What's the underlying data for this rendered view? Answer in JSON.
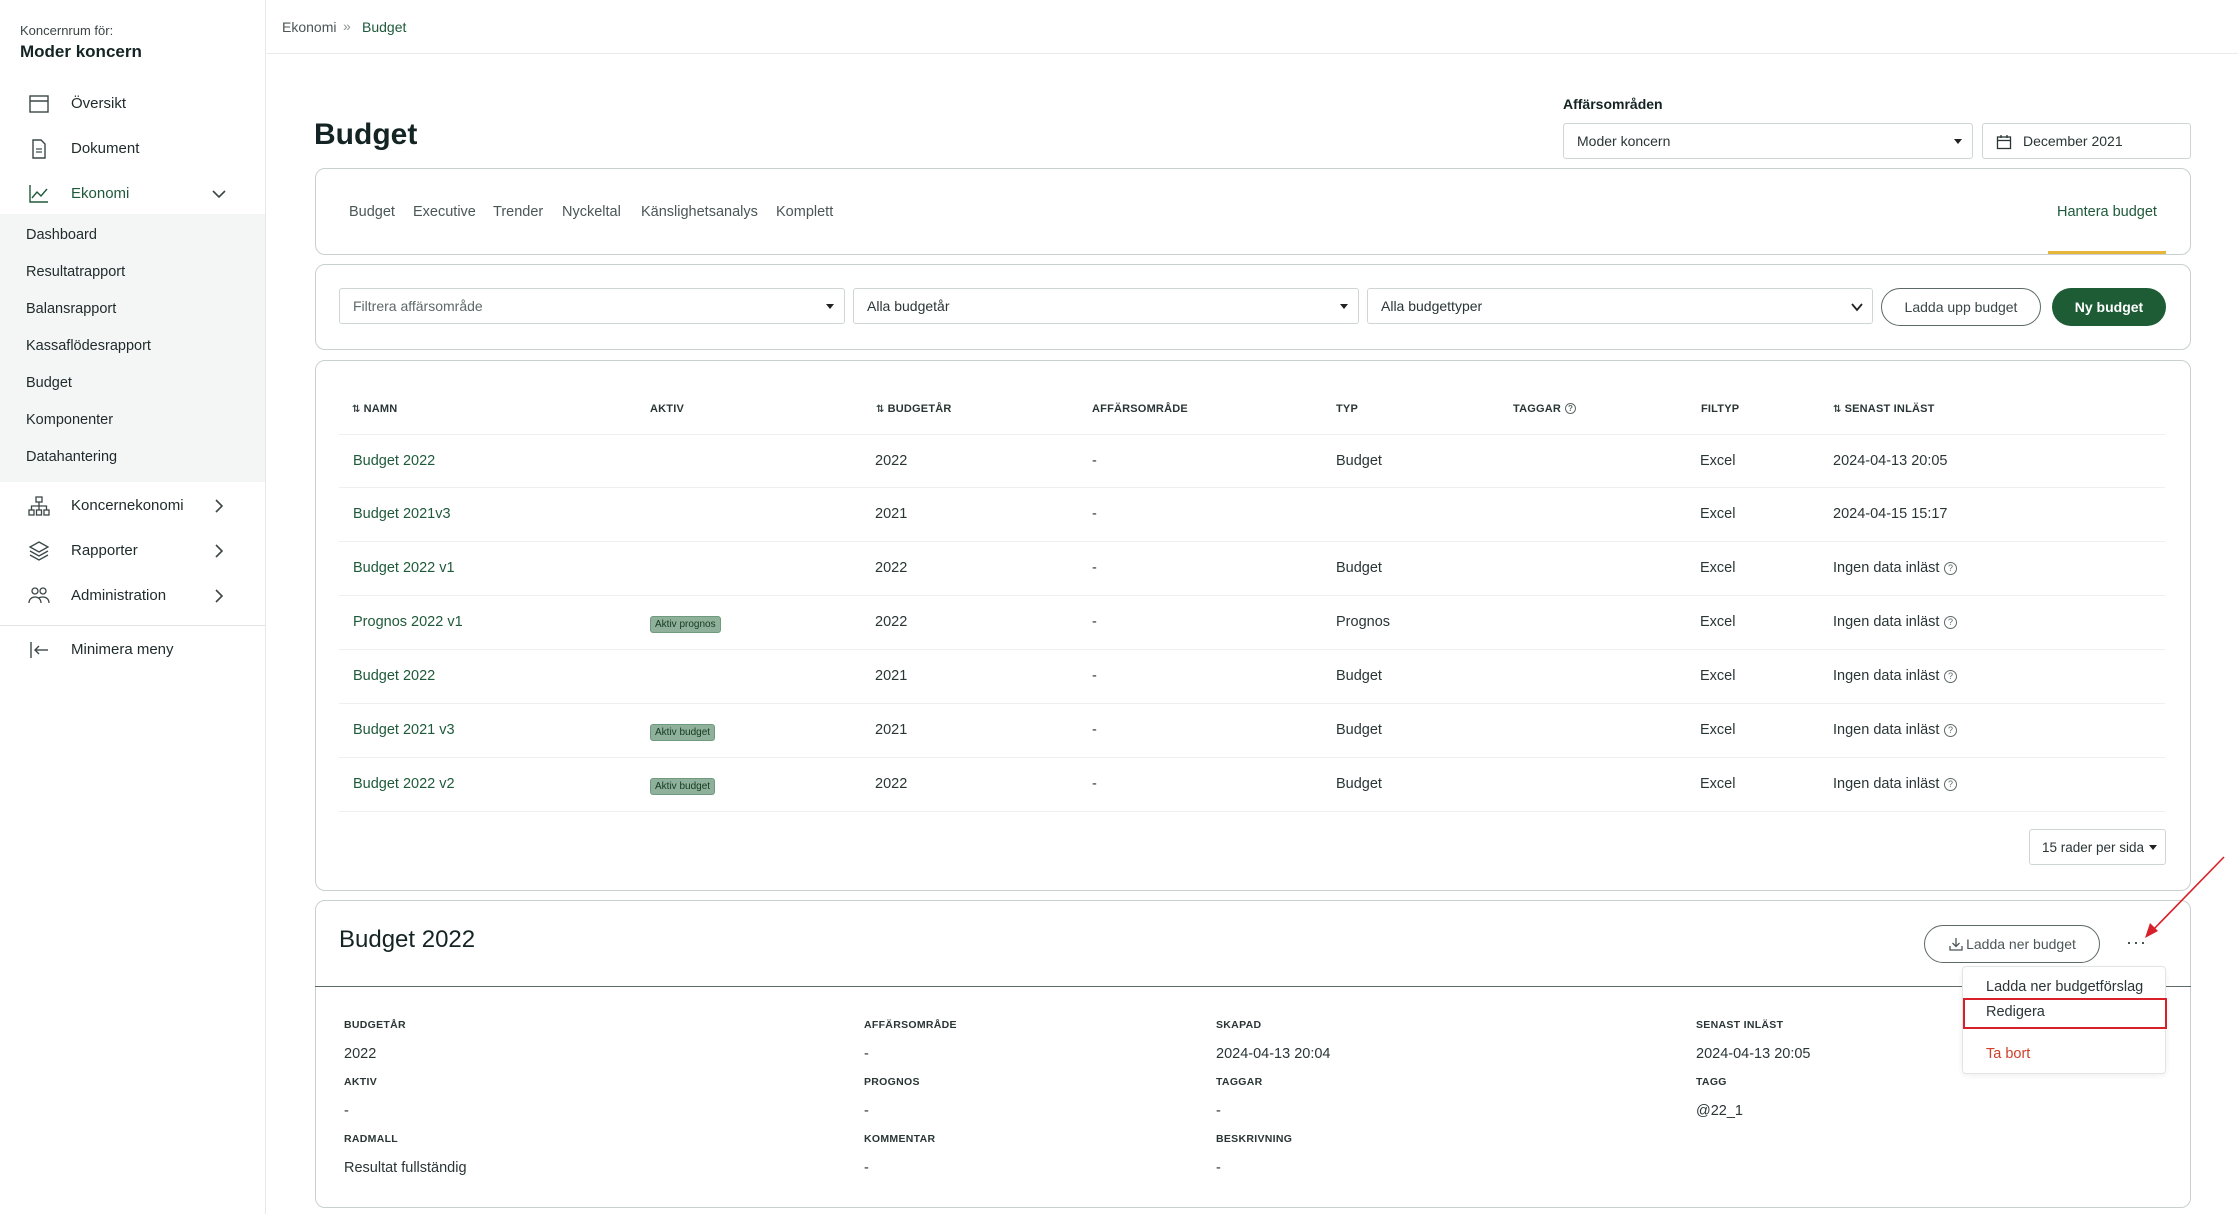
{
  "sidebar": {
    "org_label": "Koncernrum för:",
    "org_name": "Moder koncern",
    "items": [
      {
        "label": "Översikt",
        "icon": "calendar-icon"
      },
      {
        "label": "Dokument",
        "icon": "document-icon"
      },
      {
        "label": "Ekonomi",
        "icon": "chart-line-icon"
      },
      {
        "label": "Koncernekonomi",
        "icon": "org-chart-icon"
      },
      {
        "label": "Rapporter",
        "icon": "layers-icon"
      },
      {
        "label": "Administration",
        "icon": "users-icon"
      },
      {
        "label": "Minimera meny",
        "icon": "collapse-left-icon"
      }
    ],
    "ekonomi_sub": [
      "Dashboard",
      "Resultatrapport",
      "Balansrapport",
      "Kassaflödesrapport",
      "Budget",
      "Komponenter",
      "Datahantering"
    ]
  },
  "breadcrumb": {
    "parent": "Ekonomi",
    "separator": "»",
    "current": "Budget"
  },
  "page": {
    "title": "Budget",
    "affars_label": "Affärsområden",
    "affars_value": "Moder koncern",
    "date_value": "December 2021"
  },
  "tabs": [
    "Budget",
    "Executive",
    "Trender",
    "Nyckeltal",
    "Känslighetsanalys",
    "Komplett"
  ],
  "tab_right": "Hantera budget",
  "filters": {
    "area_placeholder": "Filtrera affärsområde",
    "year_value": "Alla budgetår",
    "type_value": "Alla budgettyper",
    "upload_label": "Ladda upp budget",
    "new_label": "Ny budget"
  },
  "table": {
    "headers": {
      "name": "NAMN",
      "active": "AKTIV",
      "year": "BUDGETÅR",
      "area": "AFFÄRSOMRÅDE",
      "type": "TYP",
      "tags": "TAGGAR",
      "filetype": "FILTYP",
      "loaded": "SENAST INLÄST"
    },
    "sort_glyph": "⇅",
    "rows": [
      {
        "name": "Budget 2022",
        "active": "",
        "year": "2022",
        "area": "-",
        "type": "Budget",
        "filetype": "Excel",
        "loaded": "2024-04-13 20:05",
        "help": false
      },
      {
        "name": "Budget 2021v3",
        "active": "",
        "year": "2021",
        "area": "-",
        "type": "",
        "filetype": "Excel",
        "loaded": "2024-04-15 15:17",
        "help": false
      },
      {
        "name": "Budget 2022 v1",
        "active": "",
        "year": "2022",
        "area": "-",
        "type": "Budget",
        "filetype": "Excel",
        "loaded": "Ingen data inläst",
        "help": true
      },
      {
        "name": "Prognos 2022 v1",
        "active": "Aktiv prognos",
        "year": "2022",
        "area": "-",
        "type": "Prognos",
        "filetype": "Excel",
        "loaded": "Ingen data inläst",
        "help": true
      },
      {
        "name": "Budget 2022",
        "active": "",
        "year": "2021",
        "area": "-",
        "type": "Budget",
        "filetype": "Excel",
        "loaded": "Ingen data inläst",
        "help": true
      },
      {
        "name": "Budget 2021 v3",
        "active": "Aktiv budget",
        "year": "2021",
        "area": "-",
        "type": "Budget",
        "filetype": "Excel",
        "loaded": "Ingen data inläst",
        "help": true
      },
      {
        "name": "Budget 2022 v2",
        "active": "Aktiv budget",
        "year": "2022",
        "area": "-",
        "type": "Budget",
        "filetype": "Excel",
        "loaded": "Ingen data inläst",
        "help": true
      }
    ],
    "rows_per_page": "15 rader per sida"
  },
  "detail": {
    "title": "Budget 2022",
    "download_label": "Ladda ner budget",
    "more_glyph": "···",
    "fields": {
      "budgetar_label": "BUDGETÅR",
      "budgetar_value": "2022",
      "affars_label": "AFFÄRSOMRÅDE",
      "affars_value": "-",
      "skapad_label": "SKAPAD",
      "skapad_value": "2024-04-13 20:04",
      "senast_label": "SENAST INLÄST",
      "senast_value": "2024-04-13 20:05",
      "aktiv_label": "AKTIV",
      "aktiv_value": "-",
      "prognos_label": "PROGNOS",
      "prognos_value": "-",
      "taggar_label": "TAGGAR",
      "taggar_value": "-",
      "tagg_label": "TAGG",
      "tagg_value": "@22_1",
      "radmall_label": "RADMALL",
      "radmall_value": "Resultat fullständig",
      "kommentar_label": "KOMMENTAR",
      "kommentar_value": "-",
      "beskrivning_label": "BESKRIVNING",
      "beskrivning_value": "-"
    }
  },
  "menu": {
    "items": [
      "Ladda ner budgetförslag",
      "Redigera",
      "Ta bort"
    ]
  },
  "colors": {
    "brand_green": "#1d5c35",
    "accent_yellow": "#e6b63a",
    "danger_red": "#d0402b",
    "annotation_red": "#d8202a"
  }
}
